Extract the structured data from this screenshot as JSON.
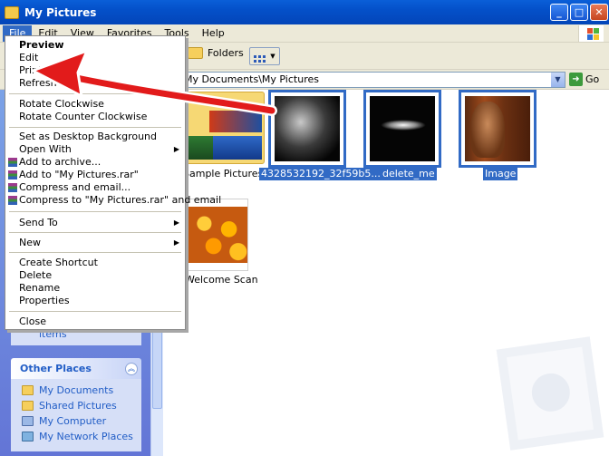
{
  "window": {
    "title": "My Pictures"
  },
  "menubar": {
    "items": [
      "File",
      "Edit",
      "View",
      "Favorites",
      "Tools",
      "Help"
    ]
  },
  "toolbar": {
    "folders_label": "Folders"
  },
  "address": {
    "value": "My Documents\\My Pictures",
    "go_label": "Go"
  },
  "sidebar": {
    "stub_text": "items",
    "other_places": {
      "title": "Other Places",
      "items": [
        "My Documents",
        "Shared Pictures",
        "My Computer",
        "My Network Places"
      ]
    }
  },
  "files": [
    {
      "name": "Sample Pictures",
      "selected": false
    },
    {
      "name": "4328532192_32f59b5...",
      "selected": true
    },
    {
      "name": "delete_me",
      "selected": true
    },
    {
      "name": "Image",
      "selected": true
    },
    {
      "name": "Welcome Scan",
      "selected": false
    }
  ],
  "file_menu": {
    "items": [
      "Preview",
      "Edit",
      "Print",
      "Refresh",
      "Rotate Clockwise",
      "Rotate Counter Clockwise",
      "Set as Desktop Background",
      "Open With",
      "Add to archive...",
      "Add to \"My Pictures.rar\"",
      "Compress and email...",
      "Compress to \"My Pictures.rar\" and email",
      "Send To",
      "New",
      "Create Shortcut",
      "Delete",
      "Rename",
      "Properties",
      "Close"
    ]
  },
  "colors": {
    "selection": "#316ac5",
    "annotation_arrow": "#e21b1b",
    "titlebar": "#0450c9"
  }
}
